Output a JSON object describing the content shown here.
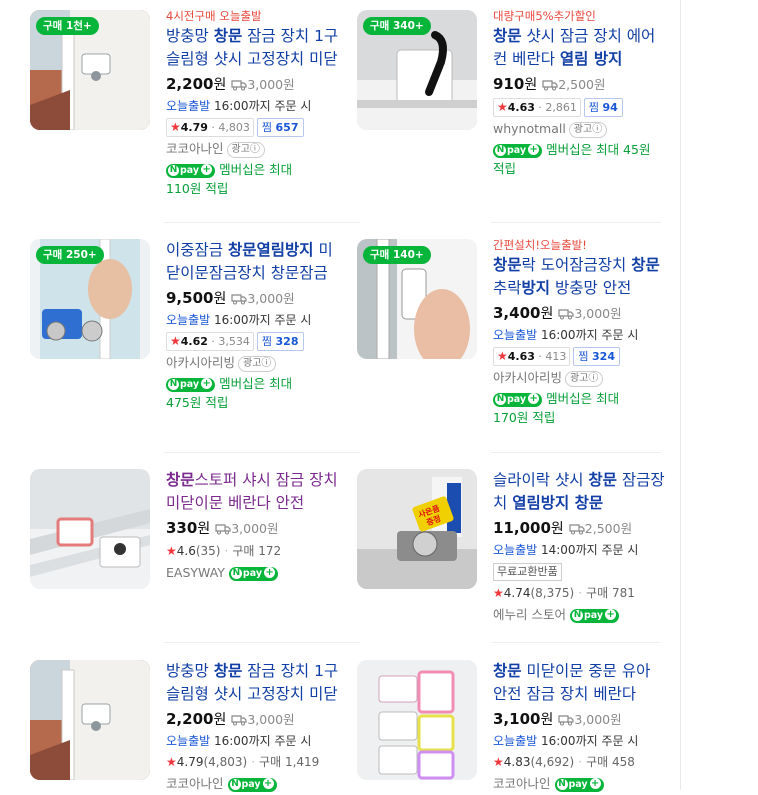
{
  "colors": {
    "buy_badge": "#07b53b",
    "title": "#123fa6",
    "promo": "#e8483c",
    "today": "#1a57d6",
    "npay": "#07b53b",
    "star": "#f0383c"
  },
  "icons": {
    "truck": "truck-icon",
    "star": "star-icon",
    "npay": "npay-plus-icon",
    "ad_info": "info-icon"
  },
  "products": [
    {
      "badge": "구매 1천+",
      "promo": "4시전구매 오늘출발",
      "title_parts": [
        {
          "t": "방충망 ",
          "b": false
        },
        {
          "t": "창문",
          "b": true
        },
        {
          "t": " 잠금 장치 1구 슬림형 샷시 고정장치 미닫이문",
          "b": false
        }
      ],
      "price": "2,200",
      "unit": "원",
      "shipping": "3,000원",
      "delivery_today": "오늘출발",
      "delivery_rest": " 16:00까지 주문 시",
      "rating": "4.79",
      "rating_count": "4,803",
      "jjim_label": "찜",
      "jjim": "657",
      "seller": "코코아나인",
      "ad": "광고ⓘ",
      "pay_text": "멤버십은 최대",
      "pay_point": "110원 적립"
    },
    {
      "badge": "구매 340+",
      "promo": "대량구매5%추가할인",
      "title_parts": [
        {
          "t": "창문",
          "b": true
        },
        {
          "t": " 샷시 잠금 장치 에어컨 베란다 ",
          "b": false
        },
        {
          "t": "열림 방지",
          "b": true
        }
      ],
      "price": "910",
      "unit": "원",
      "shipping": "2,500원",
      "rating": "4.63",
      "rating_count": "2,861",
      "jjim_label": "찜",
      "jjim": "94",
      "seller": "whynotmall",
      "ad": "광고ⓘ",
      "pay_text": "멤버십은 최대 45원",
      "pay_point": "적립"
    },
    {
      "badge": "구매 250+",
      "title_parts": [
        {
          "t": "이중잠금 ",
          "b": false
        },
        {
          "t": "창문열림방지",
          "b": true
        },
        {
          "t": " 미닫이문잠금장치 창문잠금장치",
          "b": false
        }
      ],
      "price": "9,500",
      "unit": "원",
      "shipping": "3,000원",
      "delivery_today": "오늘출발",
      "delivery_rest": " 16:00까지 주문 시",
      "rating": "4.62",
      "rating_count": "3,534",
      "jjim_label": "찜",
      "jjim": "328",
      "seller": "아카시아리빙",
      "ad": "광고ⓘ",
      "pay_text": "멤버십은 최대",
      "pay_point": "475원 적립"
    },
    {
      "badge": "구매 140+",
      "promo": "간편설치!오늘출발!",
      "title_parts": [
        {
          "t": "창문",
          "b": true
        },
        {
          "t": "락 도어잠금장치 ",
          "b": false
        },
        {
          "t": "창문",
          "b": true
        },
        {
          "t": "추락",
          "b": false
        },
        {
          "t": "방지",
          "b": true
        },
        {
          "t": " 방충망 안전",
          "b": false
        }
      ],
      "price": "3,400",
      "unit": "원",
      "shipping": "3,000원",
      "delivery_today": "오늘출발",
      "delivery_rest": " 16:00까지 주문 시",
      "rating": "4.63",
      "rating_count": "413",
      "jjim_label": "찜",
      "jjim": "324",
      "seller": "아카시아리빙",
      "ad": "광고ⓘ",
      "pay_text": "멤버십은 최대",
      "pay_point": "170원 적립"
    },
    {
      "title_parts": [
        {
          "t": "창문",
          "b": true
        },
        {
          "t": "스토퍼 샤시 잠금 장치 미닫이문 베란다 안전",
          "b": false
        }
      ],
      "title_visited": true,
      "price": "330",
      "unit": "원",
      "shipping": "3,000원",
      "rating": "4.6",
      "rating_paren": "(35)",
      "buy_label": "구매",
      "buy_count": "172",
      "seller": "EASYWAY"
    },
    {
      "title_parts": [
        {
          "t": "슬라이락 샷시 ",
          "b": false
        },
        {
          "t": "창문",
          "b": true
        },
        {
          "t": " 잠금장치 ",
          "b": false
        },
        {
          "t": "열림방지",
          "b": true
        },
        {
          "t": " 창문",
          "b": true
        }
      ],
      "price": "11,000",
      "unit": "원",
      "shipping": "2,500원",
      "delivery_today": "오늘출발",
      "delivery_rest": " 14:00까지 주문 시",
      "tag": "무료교환반품",
      "rating": "4.74",
      "rating_paren": "(8,375)",
      "buy_label": "구매",
      "buy_count": "781",
      "seller": "에누리 스토어"
    },
    {
      "title_parts": [
        {
          "t": "방충망 ",
          "b": false
        },
        {
          "t": "창문",
          "b": true
        },
        {
          "t": " 잠금 장치 1구 슬림형 샷시 고정장치 미닫이문",
          "b": false
        }
      ],
      "price": "2,200",
      "unit": "원",
      "shipping": "3,000원",
      "delivery_today": "오늘출발",
      "delivery_rest": " 16:00까지 주문 시",
      "rating": "4.79",
      "rating_paren": "(4,803)",
      "buy_label": "구매",
      "buy_count": "1,419",
      "seller": "코코아나인"
    },
    {
      "title_parts": [
        {
          "t": "창문",
          "b": true
        },
        {
          "t": " 미닫이문 중문 유아 안전 잠금 장치 베란다",
          "b": false
        }
      ],
      "price": "3,100",
      "unit": "원",
      "shipping": "3,000원",
      "delivery_today": "오늘출발",
      "delivery_rest": " 16:00까지 주문 시",
      "rating": "4.83",
      "rating_paren": "(4,692)",
      "buy_label": "구매",
      "buy_count": "458",
      "seller": "코코아나인"
    }
  ],
  "extra_texts": {
    "thumb6_sign_a": "사은품",
    "thumb6_sign_b": "증정",
    "pay_word": "pay"
  }
}
